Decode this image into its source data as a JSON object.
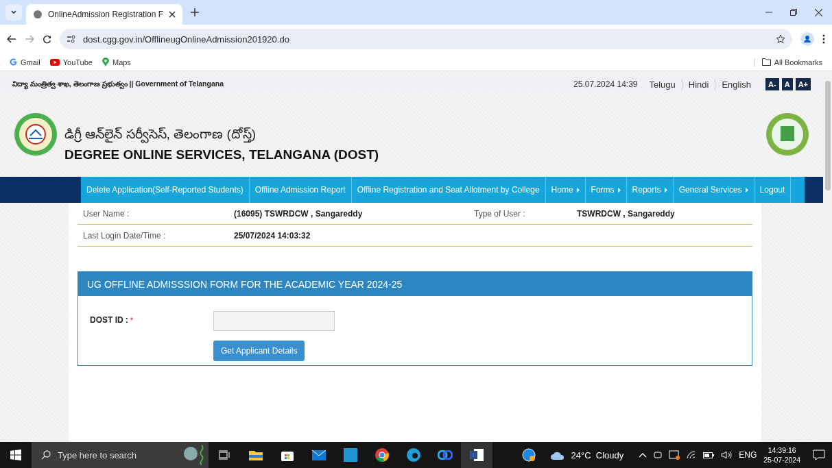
{
  "browser": {
    "tabs": [
      {
        "title": "OnlineAdmission Registration F",
        "selected": true
      }
    ],
    "url": "dost.cgg.gov.in/OfflineugOnlineAdmission201920.do",
    "bookmarks": [
      {
        "label": "Gmail",
        "kind": "gmail"
      },
      {
        "label": "YouTube",
        "kind": "youtube"
      },
      {
        "label": "Maps",
        "kind": "maps"
      }
    ],
    "all_bookmarks": "All Bookmarks"
  },
  "top_bar": {
    "ministry": "విద్యా మంత్రిత్వ శాఖ, తెలంగాణ ప్రభుత్వం || Government of Telangana",
    "datetime": "25.07.2024 14:39",
    "languages": [
      "Telugu",
      "Hindi",
      "English"
    ],
    "font_sizes": [
      "A-",
      "A",
      "A+"
    ]
  },
  "header": {
    "title_telugu": "డిగ్రీ ఆన్‌లైన్ సర్వీసెస్, తెలంగాణ (దోస్త్)",
    "title": "DEGREE ONLINE SERVICES, TELANGANA (DOST)"
  },
  "nav": [
    {
      "label": "Delete Application(Self-Reported Students)",
      "submenu": false
    },
    {
      "label": "Offline Admission Report",
      "submenu": false
    },
    {
      "label": "Offline Registration and Seat Allotment by College",
      "submenu": false
    },
    {
      "label": "Home",
      "submenu": true
    },
    {
      "label": "Forms",
      "submenu": true
    },
    {
      "label": "Reports",
      "submenu": true
    },
    {
      "label": "General Services",
      "submenu": true
    },
    {
      "label": "Logout",
      "submenu": false
    }
  ],
  "user_info": [
    {
      "label": "User Name :",
      "value": "(16095) TSWRDCW , Sangareddy",
      "label_2": "Type of User :",
      "value_2": "TSWRDCW , Sangareddy"
    },
    {
      "label": "Last Login Date/Time :",
      "value": "25/07/2024 14:03:32"
    }
  ],
  "form": {
    "title": "UG OFFLINE ADMISSSION FORM FOR THE ACADEMIC YEAR 2024-25",
    "field_label": "DOST ID :",
    "required_mark": "*",
    "button": "Get Applicant Details"
  },
  "taskbar": {
    "search_placeholder": "Type here to search",
    "weather": "24°C  Cloudy",
    "language": "ENG",
    "time": "14:39:16",
    "date": "25-07-2024"
  }
}
